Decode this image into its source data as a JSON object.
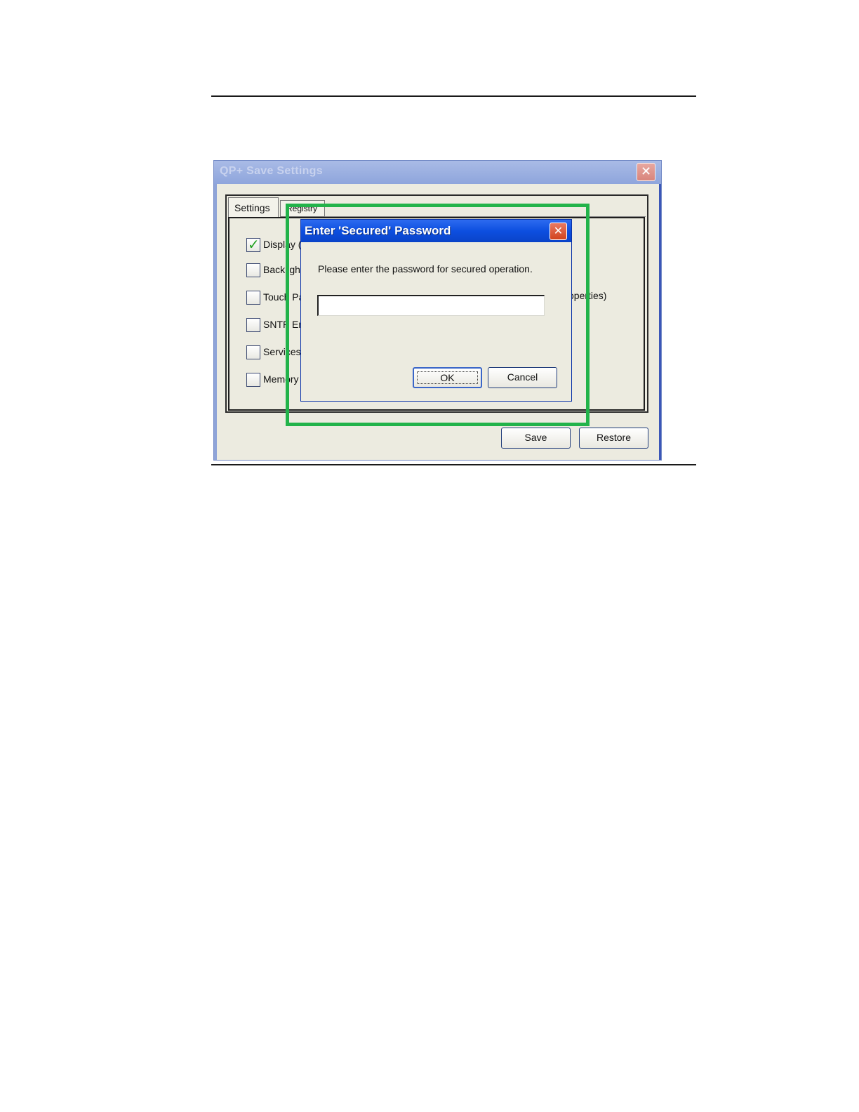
{
  "main_window": {
    "title": "QP+ Save Settings",
    "close_glyph": "✕",
    "tabs": [
      {
        "label": "Settings"
      },
      {
        "label": "Registry"
      }
    ],
    "options": [
      {
        "label": "Display (",
        "checked": true
      },
      {
        "label": "Backlight",
        "checked": false
      },
      {
        "label": "Touch Pa",
        "checked": false
      },
      {
        "label": "SNTP En",
        "checked": false
      },
      {
        "label": "Services",
        "checked": false
      },
      {
        "label": "Memory",
        "checked": false
      }
    ],
    "partial_label_right": "operties)",
    "buttons": {
      "save": "Save",
      "restore": "Restore"
    }
  },
  "dialog": {
    "title": "Enter 'Secured' Password",
    "close_glyph": "✕",
    "message": "Please enter the password for secured operation.",
    "password_value": "",
    "buttons": {
      "ok": "OK",
      "cancel": "Cancel"
    }
  },
  "colors": {
    "highlight": "#22b34a",
    "dialog_title_bar": "#0d4fe0",
    "checkmark": "#21a121"
  },
  "icons": {
    "checkbox_checked": "checkmark-icon",
    "window_close": "close-icon"
  }
}
